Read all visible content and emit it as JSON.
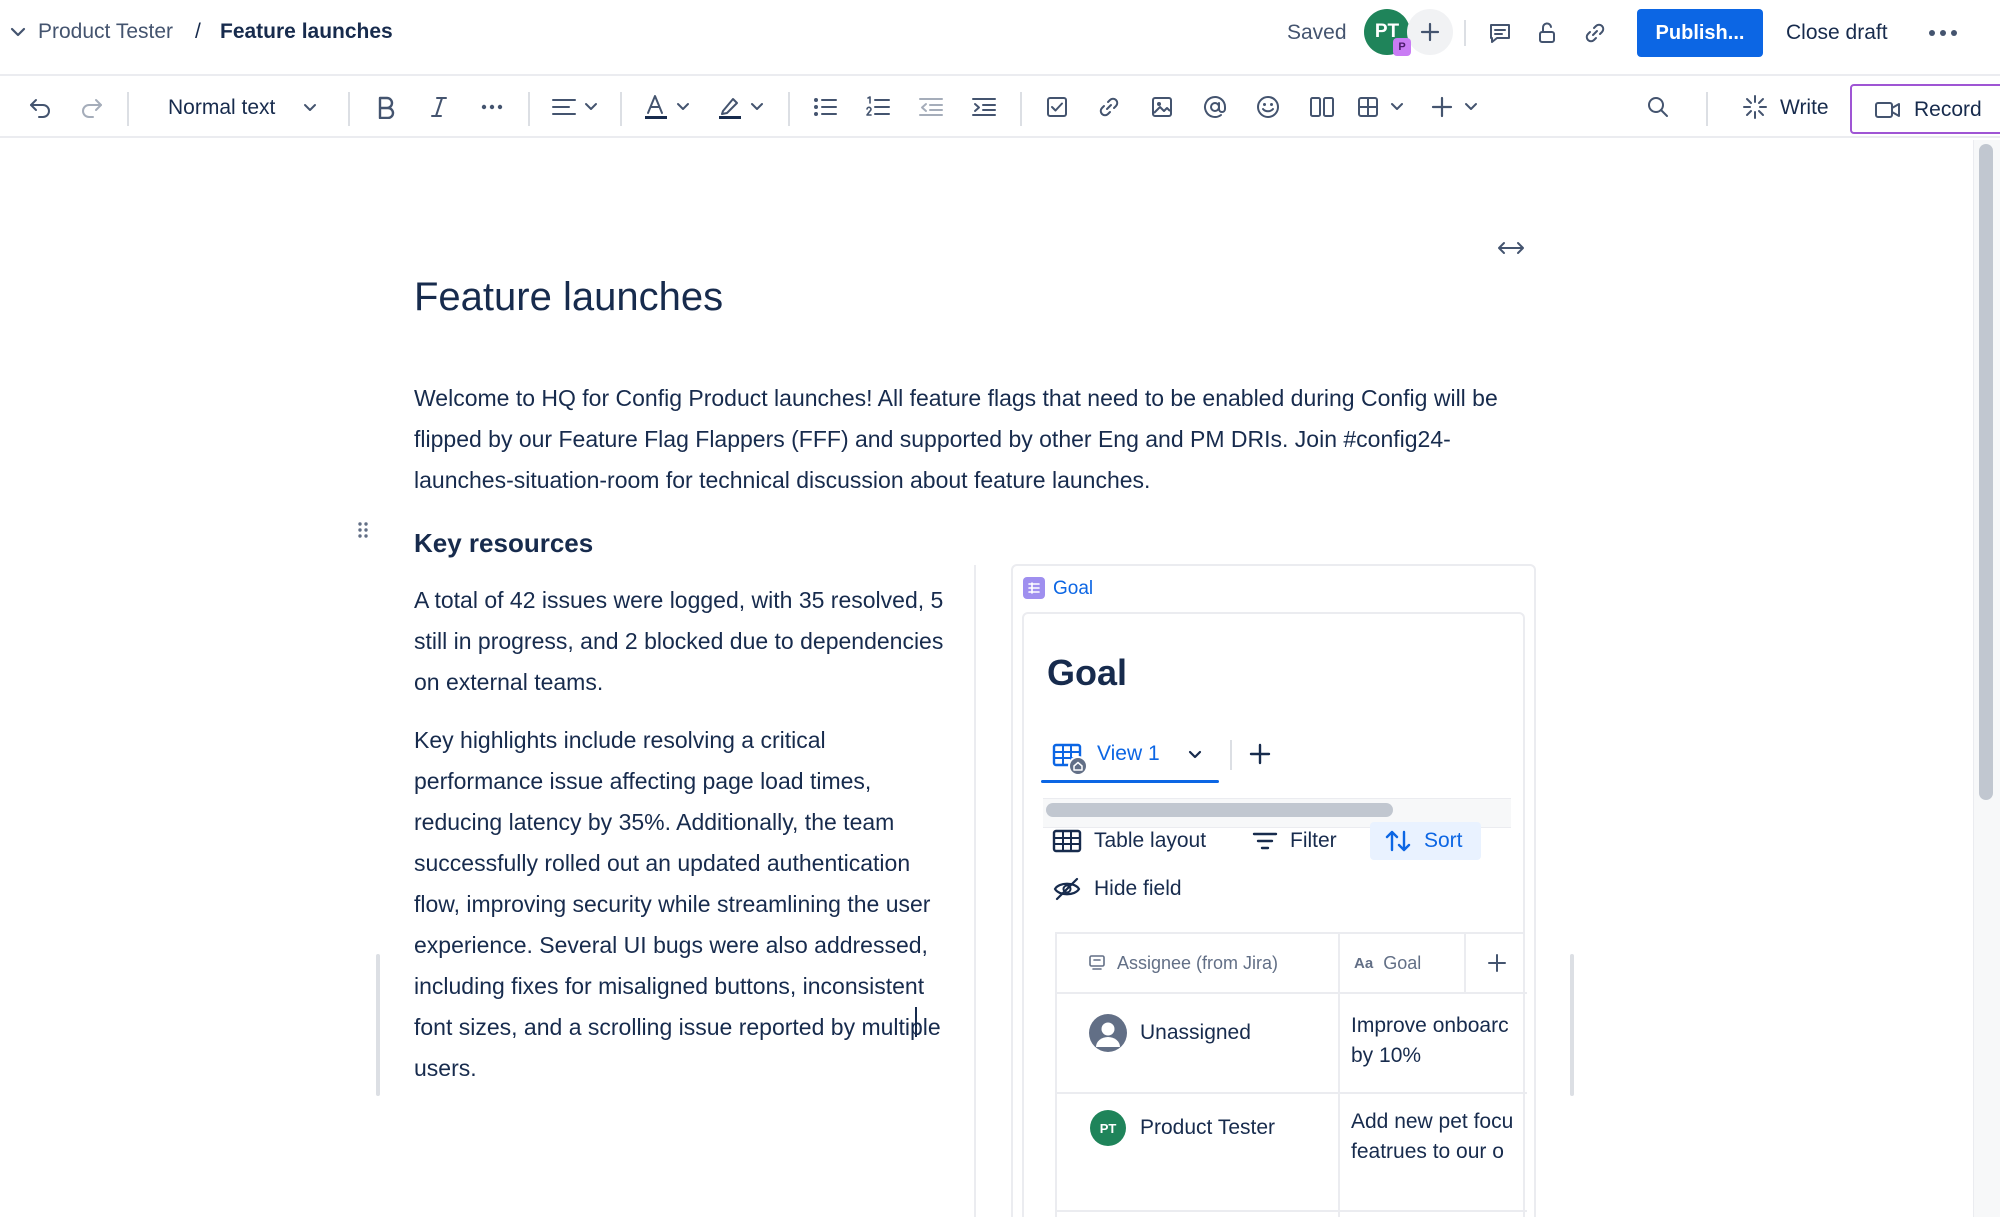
{
  "breadcrumb": {
    "parent": "Product Tester",
    "separator": "/",
    "current": "Feature launches"
  },
  "header": {
    "status": "Saved",
    "avatar_initials": "PT",
    "avatar_badge": "P",
    "publish_label": "Publish...",
    "close_draft_label": "Close draft"
  },
  "toolbar": {
    "text_style": "Normal text",
    "write_label": "Write",
    "record_label": "Record"
  },
  "page": {
    "title": "Feature launches",
    "intro": "Welcome to HQ for Config Product launches! All feature flags that need to be enabled during Config will be flipped by our Feature Flag Flappers (FFF) and supported by other Eng and PM DRIs. Join #config24-launches-situation-room for technical discussion about feature launches.",
    "section_heading": "Key resources",
    "paragraph_1": "A total of 42 issues were logged, with 35 resolved, 5 still in progress, and 2 blocked due to dependencies on external teams.",
    "paragraph_2": "Key highlights include resolving a critical performance issue affecting page load times, reducing latency by 35%. Additionally, the team successfully rolled out an updated authentication flow, improving security while streamlining the user experience. Several UI bugs were also addressed, including fixes for misaligned buttons, inconsistent font sizes, and a scrolling issue reported by multiple users."
  },
  "database": {
    "embed_label": "Goal",
    "title": "Goal",
    "view_label": "View 1",
    "actions": {
      "table_layout": "Table layout",
      "filter": "Filter",
      "sort": "Sort",
      "hide_field": "Hide field"
    },
    "columns": [
      "Assignee (from Jira)",
      "Goal"
    ],
    "goal_column_type": "Aa",
    "rows": [
      {
        "assignee": "Unassigned",
        "goal_line_1": "Improve onboarc",
        "goal_line_2": "by 10%"
      },
      {
        "assignee": "Product Tester",
        "assignee_initials": "PT",
        "goal_line_1": "Add new pet focu",
        "goal_line_2": "featrues to our o"
      }
    ]
  },
  "colors": {
    "primary": "#0c66e4",
    "avatar_green": "#1f845a",
    "record_border": "#9f55d4",
    "text": "#172b4d",
    "subtle_text": "#44546f"
  }
}
